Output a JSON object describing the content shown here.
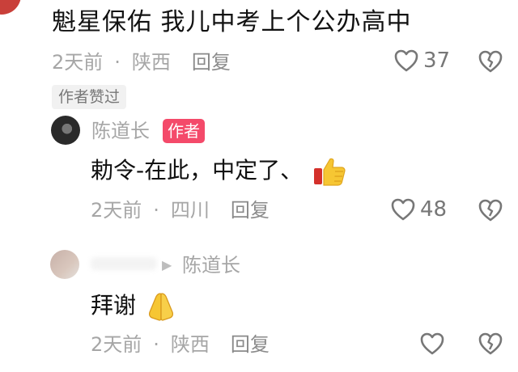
{
  "comments": [
    {
      "text": "魁星保佑 我儿中考上个公办高中",
      "time": "2天前",
      "sep": "·",
      "location": "陕西",
      "reply_label": "回复",
      "likes": "37",
      "author_liked_label": "作者赞过"
    },
    {
      "username": "陈道长",
      "author_badge": "作者",
      "text": "勅令-在此，中定了、",
      "time": "2天前",
      "sep": "·",
      "location": "四川",
      "reply_label": "回复",
      "likes": "48"
    },
    {
      "reply_to": "陈道长",
      "text": "拜谢",
      "time": "2天前",
      "sep": "·",
      "location": "陕西",
      "reply_label": "回复",
      "likes": ""
    }
  ],
  "icons": {
    "like": "heart-outline-icon",
    "dislike": "broken-heart-icon",
    "thumbs_up_emoji": "thumbs-up-emoji",
    "praying_emoji": "praying-hands-emoji",
    "reply_arrow": "play-arrow-icon"
  },
  "colors": {
    "meta_text": "#a6a6a6",
    "author_badge_bg": "#f44a6a",
    "icon_gray": "#777777"
  }
}
